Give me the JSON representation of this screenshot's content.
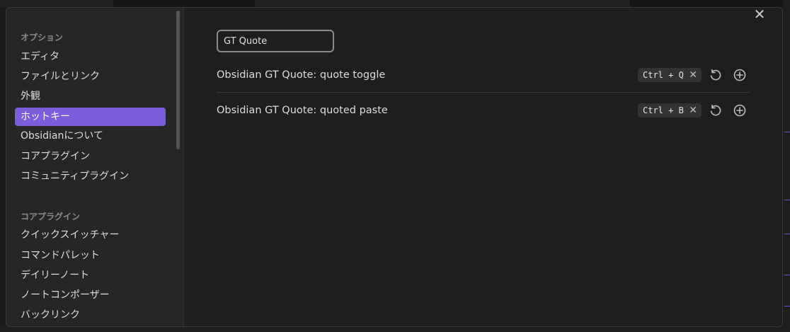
{
  "sidebar": {
    "section_options": "オプション",
    "options": [
      "エディタ",
      "ファイルとリンク",
      "外観",
      "ホットキー",
      "Obsidianについて",
      "コアプラグイン",
      "コミュニティプラグイン"
    ],
    "section_core": "コアプラグイン",
    "core": [
      "クイックスイッチャー",
      "コマンドパレット",
      "デイリーノート",
      "ノートコンポーザー",
      "バックリンク"
    ]
  },
  "search": {
    "value": "GT Quote"
  },
  "close": {
    "label": "✕"
  },
  "hotkeys": [
    {
      "name": "Obsidian GT Quote: quote toggle",
      "key": "Ctrl + Q",
      "remove_glyph": "✕"
    },
    {
      "name": "Obsidian GT Quote: quoted paste",
      "key": "Ctrl + B",
      "remove_glyph": "✕"
    }
  ],
  "icons": {
    "reset": "reset-icon",
    "add": "add-hotkey-icon"
  },
  "colors": {
    "accent": "#7c5cdb",
    "background": "#1e1e1e",
    "sidebar": "#262626"
  }
}
